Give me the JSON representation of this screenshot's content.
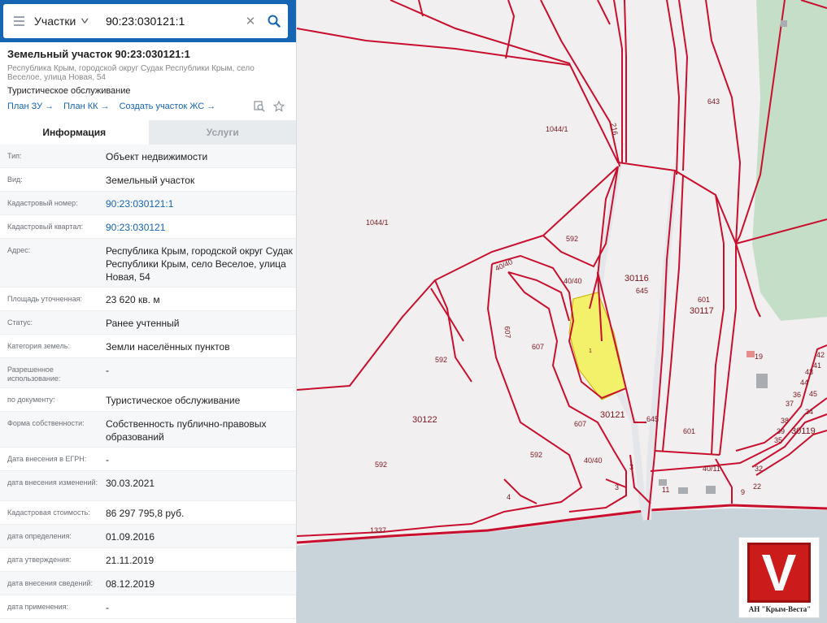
{
  "search": {
    "category": "Участки",
    "query": "90:23:030121:1"
  },
  "object": {
    "title": "Земельный участок 90:23:030121:1",
    "address": "Республика Крым, городской округ Судак Республики Крым, село Веселое, улица Новая, 54",
    "use": "Туристическое обслуживание",
    "links": [
      "План ЗУ →",
      "План КК →",
      "Создать участок ЖС →"
    ]
  },
  "tabs": {
    "info": "Информация",
    "services": "Услуги"
  },
  "properties": [
    {
      "label": "Тип:",
      "value": "Объект недвижимости"
    },
    {
      "label": "Вид:",
      "value": "Земельный участок"
    },
    {
      "label": "Кадастровый номер:",
      "value": "90:23:030121:1"
    },
    {
      "label": "Кадастровый квартал:",
      "value": "90:23:030121"
    },
    {
      "label": "Адрес:",
      "value": "Республика Крым, городской округ Судак Республики Крым, село Веселое, улица Новая, 54"
    },
    {
      "label": "Площадь уточненная:",
      "value": "23 620 кв. м"
    },
    {
      "label": "Статус:",
      "value": "Ранее учтенный"
    },
    {
      "label": "Категория земель:",
      "value": "Земли населённых пунктов"
    },
    {
      "label": "Разрешенное использование:",
      "value": "-"
    },
    {
      "label": "по документу:",
      "value": "Туристическое обслуживание"
    },
    {
      "label": "Форма собственности:",
      "value": "Собственность публично-правовых образований"
    },
    {
      "label": "Дата внесения в ЕГРН:",
      "value": "-"
    },
    {
      "label": "дата внесения изменений:",
      "value": "30.03.2021"
    },
    {
      "label": "Кадастровая стоимость:",
      "value": "86 297 795,8 руб."
    },
    {
      "label": "дата определения:",
      "value": "01.09.2016"
    },
    {
      "label": "дата утверждения:",
      "value": "21.11.2019"
    },
    {
      "label": "дата внесения сведений:",
      "value": "08.12.2019"
    },
    {
      "label": "дата применения:",
      "value": "-"
    }
  ],
  "map": {
    "parcel_labels": [
      "1044/1",
      "1044/1",
      "216",
      "643",
      "592",
      "40/40",
      "40/40",
      "30116",
      "645",
      "601",
      "30117",
      "607",
      "607",
      "607",
      "1",
      "592",
      "30122",
      "592",
      "592",
      "30121",
      "645",
      "601",
      "40/40",
      "40/11",
      "30119",
      "1337",
      "3",
      "3",
      "4",
      "9",
      "11",
      "22",
      "32",
      "35",
      "36",
      "37",
      "38",
      "39",
      "41",
      "42",
      "43",
      "44",
      "45",
      "19",
      "34",
      "40/11"
    ],
    "highlight_color": "#f3f06a",
    "boundary_color": "#c8102e"
  },
  "logo": {
    "text": "АН \"Крым-Веста\"",
    "letter": "V"
  }
}
